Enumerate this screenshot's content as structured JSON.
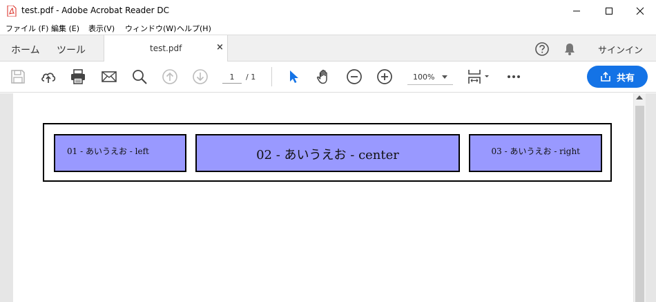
{
  "window": {
    "title": "test.pdf - Adobe Acrobat Reader DC"
  },
  "menu": {
    "items": [
      "ファイル (F)",
      "編集 (E)",
      "表示(V)",
      "ウィンドウ(W)",
      "ヘルプ(H)"
    ]
  },
  "tabs": {
    "home": "ホーム",
    "tools": "ツール",
    "document": "test.pdf",
    "close_glyph": "×",
    "signin": "サインイン"
  },
  "toolbar": {
    "page_current": "1",
    "page_total": "/  1",
    "zoom": "100%",
    "share_label": "共有",
    "accent_color": "#1473e6"
  },
  "document": {
    "cell_left": "01 - あいうえお - left",
    "cell_center": "02 - あいうえお - center",
    "cell_right": "03 - あいうえお - right",
    "cell_color": "#9999ff"
  }
}
